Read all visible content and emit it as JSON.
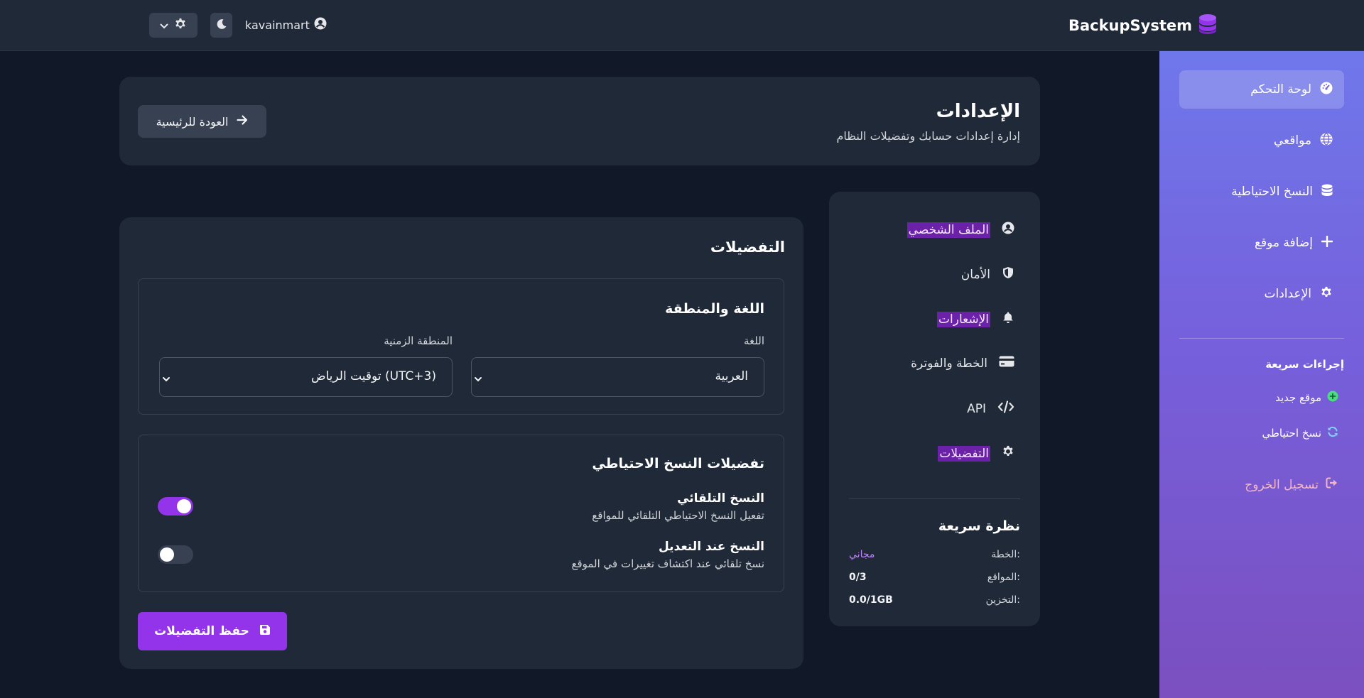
{
  "topbar": {
    "brand": "BackupSystem",
    "username": "kavainmart",
    "icons": {
      "brand": "database-icon",
      "user": "user-circle-icon",
      "theme": "moon-icon",
      "settings": "gear-icon",
      "dropdown": "chevron-down-icon"
    }
  },
  "sidebar": {
    "items": [
      {
        "label": "لوحة التحكم",
        "icon": "dashboard-gauge-icon"
      },
      {
        "label": "مواقعي",
        "icon": "globe-icon"
      },
      {
        "label": "النسخ الاحتياطية",
        "icon": "database-icon"
      },
      {
        "label": "إضافة موقع",
        "icon": "plus-icon"
      },
      {
        "label": "الإعدادات",
        "icon": "gear-icon"
      }
    ],
    "quick_actions_title": "إجراءات سريعة",
    "quick_actions": [
      {
        "label": "موقع جديد",
        "icon": "plus-circle-icon"
      },
      {
        "label": "نسخ احتياطي",
        "icon": "sync-icon"
      }
    ],
    "logout": "تسجيل الخروج",
    "colors": {
      "gradient_top": "#6f78ea",
      "gradient_bottom": "#7b4fbf"
    }
  },
  "header": {
    "title": "الإعدادات",
    "subtitle": "إدارة إعدادات حسابك وتفضيلات النظام",
    "back_button": "العودة للرئيسية"
  },
  "settings_menu": {
    "items": [
      {
        "label": "الملف الشخصي",
        "icon": "user-circle-icon"
      },
      {
        "label": "الأمان",
        "icon": "shield-icon"
      },
      {
        "label": "الإشعارات",
        "icon": "bell-icon"
      },
      {
        "label": "الخطة والفوترة",
        "icon": "credit-card-icon"
      },
      {
        "label": "API",
        "icon": "code-icon"
      },
      {
        "label": "التفضيلات",
        "icon": "gear-icon"
      }
    ],
    "quick_stats": {
      "title": "نظرة سريعة",
      "rows": [
        {
          "label": "الخطة:",
          "value": "مجاني"
        },
        {
          "label": "المواقع:",
          "value": "0/3"
        },
        {
          "label": "التخزين:",
          "value": "0.0/1GB"
        }
      ]
    }
  },
  "preferences": {
    "title": "التفضيلات",
    "language_region": {
      "title": "اللغة والمنطقة",
      "language_label": "اللغة",
      "language_value": "العربية",
      "timezone_label": "المنطقة الزمنية",
      "timezone_value": "توقيت الرياض (UTC+3)"
    },
    "backup": {
      "title": "تفضيلات النسخ الاحتياطي",
      "auto_backup_title": "النسخ التلقائي",
      "auto_backup_desc": "تفعيل النسخ الاحتياطي التلقائي للمواقع",
      "auto_backup_on": true,
      "on_change_title": "النسخ عند التعديل",
      "on_change_desc": "نسخ تلقائي عند اكتشاف تغييرات في الموقع",
      "on_change_on": false
    },
    "save_button": "حفظ التفضيلات",
    "accent": "#9333ea"
  }
}
